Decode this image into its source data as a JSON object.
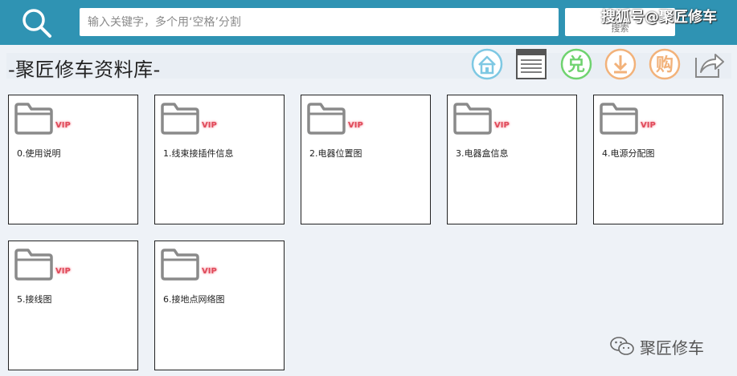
{
  "colors": {
    "topbar": "#2f93b3",
    "background": "#eef2f7",
    "home_icon": "#7ec8e3",
    "redeem_icon": "#6fd36f",
    "download_icon": "#f2b27a",
    "buy_icon": "#f2b27a",
    "vip_text": "#e04a5a",
    "folder": "#8a8a8a"
  },
  "search": {
    "placeholder": "输入关键字，多个用‘空格’分割",
    "button_label": "搜索"
  },
  "watermark_top": "搜狐号@聚匠修车",
  "page_title": "-聚匠修车资料库-",
  "toolbar": [
    {
      "name": "home-icon",
      "glyph": "house"
    },
    {
      "name": "catalog-icon",
      "glyph": "window"
    },
    {
      "name": "redeem-icon",
      "glyph": "兑"
    },
    {
      "name": "download-icon",
      "glyph": "arrow-down"
    },
    {
      "name": "buy-icon",
      "glyph": "购"
    },
    {
      "name": "share-icon",
      "glyph": "share"
    }
  ],
  "redeem_glyph": "兑",
  "buy_glyph": "购",
  "vip_badge": "VIP",
  "folders": [
    {
      "label": "0.使用说明"
    },
    {
      "label": "1.线束接插件信息"
    },
    {
      "label": "2.电器位置图"
    },
    {
      "label": "3.电器盒信息"
    },
    {
      "label": "4.电源分配图"
    },
    {
      "label": "5.接线图"
    },
    {
      "label": "6.接地点网络图"
    }
  ],
  "wechat_watermark": "聚匠修车"
}
